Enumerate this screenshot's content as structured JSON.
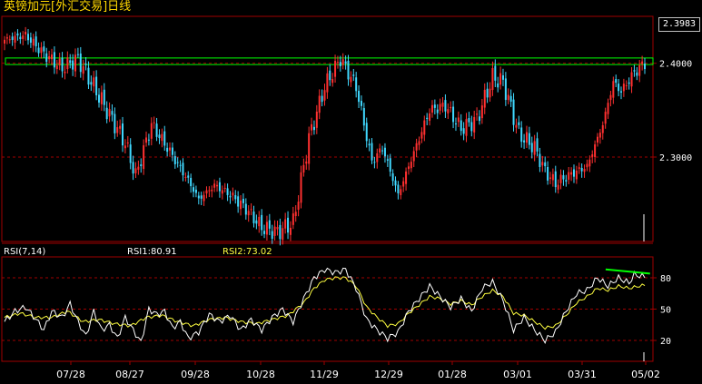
{
  "window": {
    "title": "英镑加元[外汇交易]日线"
  },
  "price_readout": "2.3983",
  "indicator_header": {
    "name": "RSI(7,14)",
    "rsi1": "RSI1:80.91",
    "rsi2": "RSI2:73.02"
  },
  "colors": {
    "background": "#000000",
    "up_candle": "#ff3030",
    "down_candle": "#40d8ff",
    "grid": "#a00000",
    "frame": "#a00000",
    "resistance_band": "#00ff00",
    "rsi1_line": "#ffffff",
    "rsi2_line": "#ffff40",
    "divergence_line": "#00ff00",
    "axis_text": "#ffffff",
    "title_text": "#ffd700"
  },
  "chart_data": [
    {
      "type": "candlestick",
      "title": "英镑加元[外汇交易]日线",
      "ylim": [
        2.21,
        2.45
      ],
      "y_ticks": [
        2.3,
        2.4
      ],
      "y_tick_labels": [
        "2.3000",
        "2.4000"
      ],
      "grid": true,
      "resistance_band": [
        2.3986,
        2.4056
      ],
      "last_value": 2.3983,
      "x_tick_labels": [
        "07/28",
        "08/27",
        "09/28",
        "10/28",
        "11/29",
        "12/29",
        "01/28",
        "03/01",
        "03/31",
        "05/02"
      ],
      "anchors": [
        [
          0,
          2.425
        ],
        [
          8,
          2.43
        ],
        [
          15,
          2.41
        ],
        [
          22,
          2.395
        ],
        [
          28,
          2.405
        ],
        [
          34,
          2.375
        ],
        [
          40,
          2.345
        ],
        [
          46,
          2.315
        ],
        [
          50,
          2.28
        ],
        [
          56,
          2.335
        ],
        [
          62,
          2.31
        ],
        [
          70,
          2.275
        ],
        [
          74,
          2.255
        ],
        [
          80,
          2.27
        ],
        [
          86,
          2.26
        ],
        [
          92,
          2.245
        ],
        [
          98,
          2.225
        ],
        [
          104,
          2.22
        ],
        [
          110,
          2.23
        ],
        [
          116,
          2.32
        ],
        [
          122,
          2.375
        ],
        [
          128,
          2.405
        ],
        [
          134,
          2.375
        ],
        [
          140,
          2.295
        ],
        [
          144,
          2.31
        ],
        [
          150,
          2.26
        ],
        [
          156,
          2.305
        ],
        [
          162,
          2.35
        ],
        [
          168,
          2.355
        ],
        [
          174,
          2.33
        ],
        [
          180,
          2.34
        ],
        [
          186,
          2.385
        ],
        [
          190,
          2.38
        ],
        [
          196,
          2.325
        ],
        [
          202,
          2.31
        ],
        [
          206,
          2.285
        ],
        [
          210,
          2.272
        ],
        [
          216,
          2.282
        ],
        [
          222,
          2.29
        ],
        [
          228,
          2.335
        ],
        [
          232,
          2.38
        ],
        [
          235,
          2.37
        ],
        [
          240,
          2.39
        ],
        [
          244,
          2.4
        ]
      ]
    },
    {
      "type": "line",
      "title": "RSI(7,14)",
      "ylim": [
        0,
        100
      ],
      "y_ticks": [
        20,
        50,
        80
      ],
      "grid": true,
      "series": [
        {
          "name": "RSI1",
          "last_value": 80.91,
          "points": [
            [
              0,
              38
            ],
            [
              4,
              48
            ],
            [
              8,
              52
            ],
            [
              12,
              40
            ],
            [
              15,
              30
            ],
            [
              18,
              48
            ],
            [
              22,
              42
            ],
            [
              25,
              55
            ],
            [
              28,
              38
            ],
            [
              31,
              24
            ],
            [
              34,
              48
            ],
            [
              37,
              30
            ],
            [
              40,
              35
            ],
            [
              43,
              22
            ],
            [
              46,
              42
            ],
            [
              49,
              30
            ],
            [
              52,
              18
            ],
            [
              55,
              50
            ],
            [
              58,
              45
            ],
            [
              61,
              48
            ],
            [
              64,
              32
            ],
            [
              67,
              38
            ],
            [
              70,
              22
            ],
            [
              74,
              28
            ],
            [
              78,
              45
            ],
            [
              82,
              38
            ],
            [
              86,
              44
            ],
            [
              90,
              30
            ],
            [
              94,
              40
            ],
            [
              98,
              30
            ],
            [
              102,
              42
            ],
            [
              106,
              50
            ],
            [
              110,
              38
            ],
            [
              114,
              60
            ],
            [
              118,
              80
            ],
            [
              122,
              88
            ],
            [
              126,
              85
            ],
            [
              130,
              88
            ],
            [
              134,
              70
            ],
            [
              138,
              40
            ],
            [
              142,
              30
            ],
            [
              146,
              22
            ],
            [
              150,
              28
            ],
            [
              154,
              48
            ],
            [
              158,
              60
            ],
            [
              162,
              72
            ],
            [
              166,
              62
            ],
            [
              170,
              52
            ],
            [
              174,
              60
            ],
            [
              178,
              48
            ],
            [
              182,
              70
            ],
            [
              186,
              76
            ],
            [
              190,
              58
            ],
            [
              194,
              30
            ],
            [
              198,
              42
            ],
            [
              202,
              30
            ],
            [
              206,
              20
            ],
            [
              210,
              28
            ],
            [
              214,
              48
            ],
            [
              218,
              65
            ],
            [
              222,
              68
            ],
            [
              226,
              80
            ],
            [
              230,
              72
            ],
            [
              234,
              80
            ],
            [
              238,
              75
            ],
            [
              240,
              83
            ],
            [
              244,
              80.91
            ]
          ]
        },
        {
          "name": "RSI2",
          "last_value": 73.02,
          "points": [
            [
              0,
              42
            ],
            [
              6,
              46
            ],
            [
              12,
              42
            ],
            [
              18,
              42
            ],
            [
              24,
              48
            ],
            [
              30,
              38
            ],
            [
              36,
              40
            ],
            [
              42,
              36
            ],
            [
              48,
              34
            ],
            [
              54,
              42
            ],
            [
              60,
              44
            ],
            [
              66,
              38
            ],
            [
              72,
              34
            ],
            [
              78,
              40
            ],
            [
              84,
              42
            ],
            [
              90,
              38
            ],
            [
              96,
              36
            ],
            [
              102,
              40
            ],
            [
              108,
              44
            ],
            [
              114,
              56
            ],
            [
              118,
              70
            ],
            [
              122,
              78
            ],
            [
              126,
              80
            ],
            [
              130,
              80
            ],
            [
              134,
              72
            ],
            [
              138,
              52
            ],
            [
              142,
              42
            ],
            [
              146,
              34
            ],
            [
              150,
              36
            ],
            [
              154,
              46
            ],
            [
              158,
              54
            ],
            [
              162,
              62
            ],
            [
              166,
              60
            ],
            [
              170,
              55
            ],
            [
              174,
              58
            ],
            [
              178,
              54
            ],
            [
              182,
              62
            ],
            [
              186,
              68
            ],
            [
              190,
              62
            ],
            [
              194,
              46
            ],
            [
              198,
              44
            ],
            [
              202,
              38
            ],
            [
              206,
              32
            ],
            [
              210,
              34
            ],
            [
              214,
              44
            ],
            [
              218,
              56
            ],
            [
              222,
              62
            ],
            [
              226,
              70
            ],
            [
              230,
              68
            ],
            [
              234,
              72
            ],
            [
              238,
              70
            ],
            [
              244,
              73.02
            ]
          ]
        }
      ],
      "divergence_line": [
        [
          236,
          88
        ],
        [
          246,
          84
        ]
      ]
    }
  ]
}
